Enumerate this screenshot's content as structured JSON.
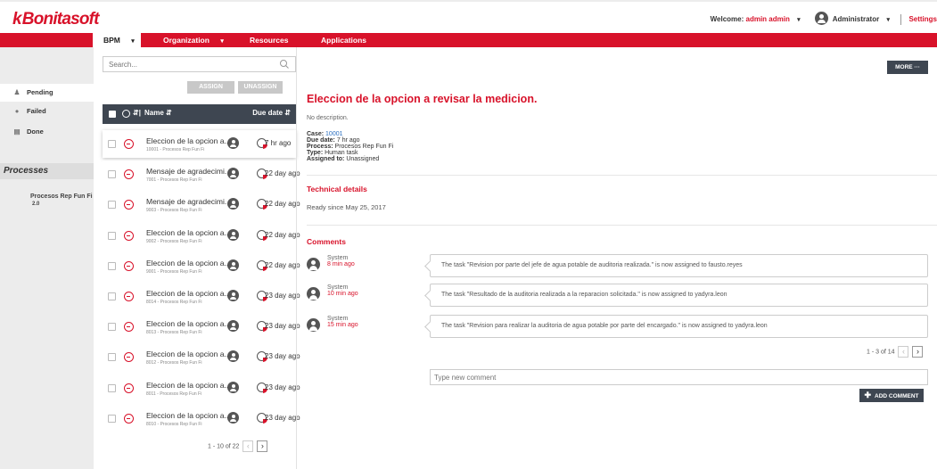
{
  "header": {
    "logo_text": "Bonitasoft",
    "welcome_label": "Welcome:",
    "user_name": "admin admin",
    "role": "Administrator",
    "settings_label": "Settings"
  },
  "nav": {
    "bpm": "BPM",
    "organization": "Organization",
    "resources": "Resources",
    "applications": "Applications"
  },
  "sidebar": {
    "pending": "Pending",
    "failed": "Failed",
    "done": "Done",
    "processes_title": "Processes",
    "process_name": "Procesos Rep Fun Fi",
    "process_version": "2.0"
  },
  "list": {
    "search_placeholder": "Search...",
    "assign_label": "ASSIGN",
    "unassign_label": "UNASSIGN",
    "col_name": "Name",
    "col_due": "Due date",
    "rows": [
      {
        "name": "Eleccion de la opcion a...",
        "sub": "10001 - Procesos Rep Fun Fi",
        "due": "7 hr ago"
      },
      {
        "name": "Mensaje de agradecimi...",
        "sub": "7001 - Procesos Rep Fun Fi",
        "due": "22 day ago"
      },
      {
        "name": "Mensaje de agradecimi...",
        "sub": "9003 - Procesos Rep Fun Fi",
        "due": "22 day ago"
      },
      {
        "name": "Eleccion de la opcion a...",
        "sub": "9002 - Procesos Rep Fun Fi",
        "due": "22 day ago"
      },
      {
        "name": "Eleccion de la opcion a...",
        "sub": "9001 - Procesos Rep Fun Fi",
        "due": "22 day ago"
      },
      {
        "name": "Eleccion de la opcion a...",
        "sub": "8014 - Procesos Rep Fun Fi",
        "due": "23 day ago"
      },
      {
        "name": "Eleccion de la opcion a...",
        "sub": "8013 - Procesos Rep Fun Fi",
        "due": "23 day ago"
      },
      {
        "name": "Eleccion de la opcion a...",
        "sub": "8012 - Procesos Rep Fun Fi",
        "due": "23 day ago"
      },
      {
        "name": "Eleccion de la opcion a...",
        "sub": "8011 - Procesos Rep Fun Fi",
        "due": "23 day ago"
      },
      {
        "name": "Eleccion de la opcion a...",
        "sub": "8010 - Procesos Rep Fun Fi",
        "due": "23 day ago"
      }
    ],
    "pager_text": "1 - 10 of 22"
  },
  "detail": {
    "more_label": "MORE",
    "title": "Eleccion de la opcion a revisar la medicion.",
    "description": "No description.",
    "case_label": "Case:",
    "case_value": "10001",
    "due_label": "Due date:",
    "due_value": "7 hr ago",
    "process_label": "Process:",
    "process_value": "Procesos Rep Fun Fi",
    "type_label": "Type:",
    "type_value": "Human task",
    "assigned_label": "Assigned to:",
    "assigned_value": "Unassigned",
    "technical_title": "Technical details",
    "ready_since": "Ready since May 25, 2017",
    "comments_title": "Comments",
    "comments": [
      {
        "author": "System",
        "time": "8 min ago",
        "text": "The task \"Revision por parte del jefe de agua potable de auditoria realizada.\" is now assigned to fausto.reyes"
      },
      {
        "author": "System",
        "time": "10 min ago",
        "text": "The task \"Resultado de la auditoria realizada a la reparacion solicitada.\" is now assigned to yadyra.leon"
      },
      {
        "author": "System",
        "time": "15 min ago",
        "text": "The task \"Revision para realizar la auditoria de agua potable por parte del encargado.\" is now assigned to yadyra.leon"
      }
    ],
    "comments_pager": "1 - 3 of 14",
    "new_comment_placeholder": "Type new comment",
    "add_comment_label": "ADD COMMENT"
  },
  "colors": {
    "brand_red": "#d8122a",
    "dark_header": "#3e4651",
    "sidebar_bg": "#ececec"
  }
}
